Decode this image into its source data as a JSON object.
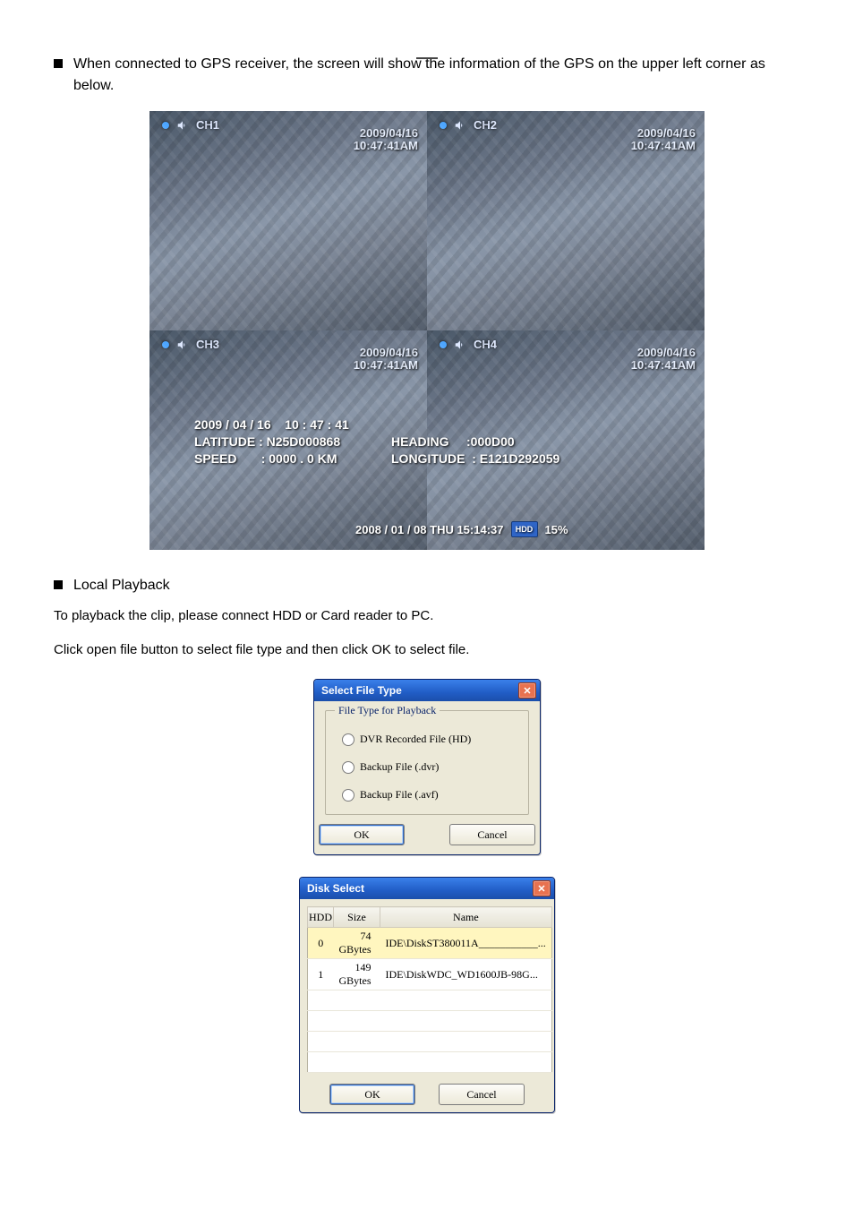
{
  "doc": {
    "bullet1": "When connected to GPS receiver, the screen will show the information of the GPS on the upper left corner as below.",
    "bullet2_title": "Local Playback",
    "para1": "To playback the clip, please connect HDD or Card reader to PC.",
    "para2": "Click open file button to select file type and then click OK to select file."
  },
  "quad": {
    "ch1": {
      "name": "CH1",
      "ts": "2009/04/16\n10:47:41AM"
    },
    "ch2": {
      "name": "CH2",
      "ts": "2009/04/16\n10:47:41AM"
    },
    "ch3": {
      "name": "CH3",
      "ts": "2009/04/16\n10:47:41AM"
    },
    "ch4": {
      "name": "CH4",
      "ts": "2009/04/16\n10:47:41AM"
    },
    "gps_left": "2009 / 04 / 16    10 : 47 : 41\nLATITUDE : N25D000868\nSPEED       : 0000 . 0 KM",
    "gps_right": "HEADING     :000D00\nLONGITUDE  : E121D292059",
    "status": {
      "datetime": "2008 / 01 / 08   THU   15:14:37",
      "badge": "HDD",
      "percent": "15%"
    }
  },
  "dialog1": {
    "title": "Select File Type",
    "legend": "File Type for Playback",
    "options": [
      "DVR Recorded File (HD)",
      "Backup File (.dvr)",
      "Backup File (.avf)"
    ],
    "ok": "OK",
    "cancel": "Cancel"
  },
  "dialog2": {
    "title": "Disk Select",
    "cols": [
      "HDD",
      "Size",
      "Name"
    ],
    "rows": [
      {
        "hdd": "0",
        "size": "74 GBytes",
        "name": "IDE\\DiskST380011A___________..."
      },
      {
        "hdd": "1",
        "size": "149 GBytes",
        "name": "IDE\\DiskWDC_WD1600JB-98G..."
      }
    ],
    "ok": "OK",
    "cancel": "Cancel"
  }
}
